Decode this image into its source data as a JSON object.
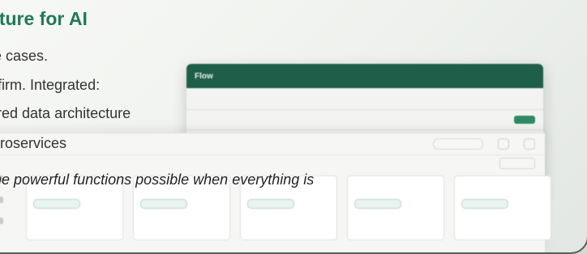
{
  "card": {
    "heading": "ucture for AI",
    "lines": [
      "age cases.",
      "he firm. Integrated:",
      "ctured data architecture",
      "microservices"
    ],
    "quote": "e the powerful functions possible when everything is"
  },
  "app_back": {
    "logo": "Flow",
    "nav": [
      "",
      "",
      "",
      "",
      ""
    ],
    "accent": "#1f5f4a"
  },
  "app_front": {
    "logo": "",
    "accent": "#2f8a63"
  }
}
